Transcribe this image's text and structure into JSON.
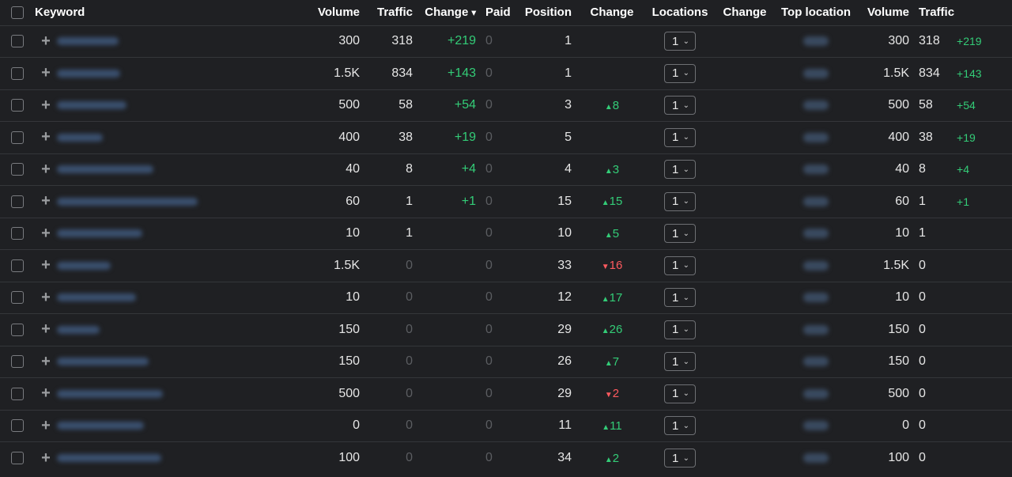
{
  "header": {
    "keyword": "Keyword",
    "volume": "Volume",
    "traffic": "Traffic",
    "change": "Change",
    "sort_indicator": "▾",
    "paid": "Paid",
    "position": "Position",
    "change2": "Change",
    "locations": "Locations",
    "change3": "Change",
    "top_location": "Top location",
    "volume2": "Volume",
    "traffic2": "Traffic"
  },
  "rows": [
    {
      "volume": "300",
      "traffic": "318",
      "change": "+219",
      "paid": "0",
      "position": "1",
      "pos_change": "",
      "dir": "",
      "locations": "1",
      "volume2": "300",
      "traffic2": "318",
      "change2": "+219"
    },
    {
      "volume": "1.5K",
      "traffic": "834",
      "change": "+143",
      "paid": "0",
      "position": "1",
      "pos_change": "",
      "dir": "",
      "locations": "1",
      "volume2": "1.5K",
      "traffic2": "834",
      "change2": "+143"
    },
    {
      "volume": "500",
      "traffic": "58",
      "change": "+54",
      "paid": "0",
      "position": "3",
      "pos_change": "8",
      "dir": "up",
      "locations": "1",
      "volume2": "500",
      "traffic2": "58",
      "change2": "+54"
    },
    {
      "volume": "400",
      "traffic": "38",
      "change": "+19",
      "paid": "0",
      "position": "5",
      "pos_change": "",
      "dir": "",
      "locations": "1",
      "volume2": "400",
      "traffic2": "38",
      "change2": "+19"
    },
    {
      "volume": "40",
      "traffic": "8",
      "change": "+4",
      "paid": "0",
      "position": "4",
      "pos_change": "3",
      "dir": "up",
      "locations": "1",
      "volume2": "40",
      "traffic2": "8",
      "change2": "+4"
    },
    {
      "volume": "60",
      "traffic": "1",
      "change": "+1",
      "paid": "0",
      "position": "15",
      "pos_change": "15",
      "dir": "up",
      "locations": "1",
      "volume2": "60",
      "traffic2": "1",
      "change2": "+1"
    },
    {
      "volume": "10",
      "traffic": "1",
      "change": "",
      "paid": "0",
      "position": "10",
      "pos_change": "5",
      "dir": "up",
      "locations": "1",
      "volume2": "10",
      "traffic2": "1",
      "change2": ""
    },
    {
      "volume": "1.5K",
      "traffic": "0",
      "change": "",
      "paid": "0",
      "position": "33",
      "pos_change": "16",
      "dir": "down",
      "locations": "1",
      "volume2": "1.5K",
      "traffic2": "0",
      "change2": ""
    },
    {
      "volume": "10",
      "traffic": "0",
      "change": "",
      "paid": "0",
      "position": "12",
      "pos_change": "17",
      "dir": "up",
      "locations": "1",
      "volume2": "10",
      "traffic2": "0",
      "change2": ""
    },
    {
      "volume": "150",
      "traffic": "0",
      "change": "",
      "paid": "0",
      "position": "29",
      "pos_change": "26",
      "dir": "up",
      "locations": "1",
      "volume2": "150",
      "traffic2": "0",
      "change2": ""
    },
    {
      "volume": "150",
      "traffic": "0",
      "change": "",
      "paid": "0",
      "position": "26",
      "pos_change": "7",
      "dir": "up",
      "locations": "1",
      "volume2": "150",
      "traffic2": "0",
      "change2": ""
    },
    {
      "volume": "500",
      "traffic": "0",
      "change": "",
      "paid": "0",
      "position": "29",
      "pos_change": "2",
      "dir": "down",
      "locations": "1",
      "volume2": "500",
      "traffic2": "0",
      "change2": ""
    },
    {
      "volume": "0",
      "traffic": "0",
      "change": "",
      "paid": "0",
      "position": "11",
      "pos_change": "11",
      "dir": "up",
      "locations": "1",
      "volume2": "0",
      "traffic2": "0",
      "change2": ""
    },
    {
      "volume": "100",
      "traffic": "0",
      "change": "",
      "paid": "0",
      "position": "34",
      "pos_change": "2",
      "dir": "up",
      "locations": "1",
      "volume2": "100",
      "traffic2": "0",
      "change2": ""
    }
  ],
  "colors": {
    "background": "#1f2023",
    "positive": "#33cc77",
    "negative": "#ff5a5f",
    "muted": "#5b5d61"
  },
  "icons": {
    "up": "triangle-up-icon",
    "down": "triangle-down-icon",
    "add": "plus-icon",
    "dropdown": "chevron-down-icon"
  }
}
